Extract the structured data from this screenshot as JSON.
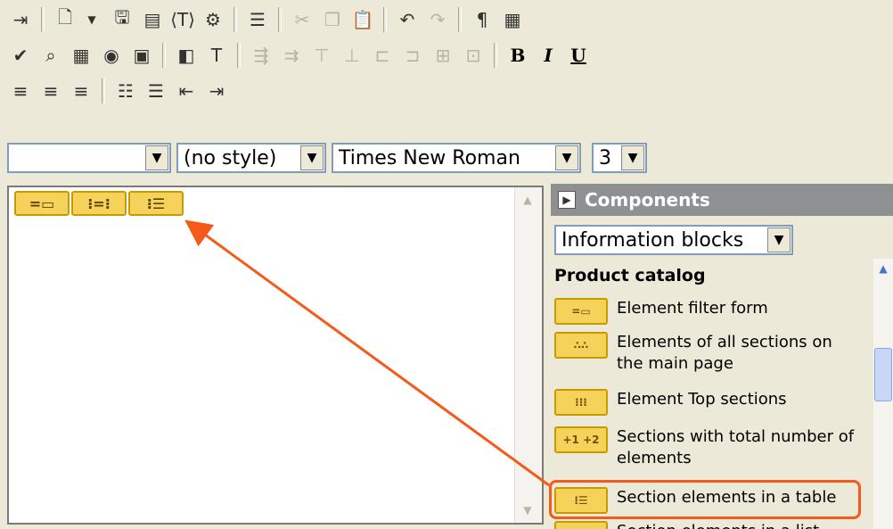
{
  "toolbar": {
    "font_buttons": {
      "bold": "B",
      "italic": "I",
      "underline": "U"
    }
  },
  "formatting": {
    "format_select": "",
    "style_select": "(no style)",
    "font_select": "Times New Roman",
    "size_select": "3"
  },
  "components_panel": {
    "title": "Components",
    "dropdown": "Information blocks",
    "category": "Product catalog",
    "items": [
      {
        "label": "Element filter form",
        "icon": "element-filter-icon"
      },
      {
        "label": "Elements of all sections on the main page",
        "icon": "all-sections-icon"
      },
      {
        "label": "Element Top sections",
        "icon": "top-sections-icon"
      },
      {
        "label": "Sections with total number of elements",
        "icon": "sections-count-icon"
      },
      {
        "label": "Section elements in a table",
        "icon": "table-elements-icon"
      },
      {
        "label": "Section elements in a list",
        "icon": "list-elements-icon"
      }
    ]
  },
  "colors": {
    "accent": "#f45a1a",
    "component_icon": "#f5d25a",
    "panel_header": "#8e9092"
  }
}
